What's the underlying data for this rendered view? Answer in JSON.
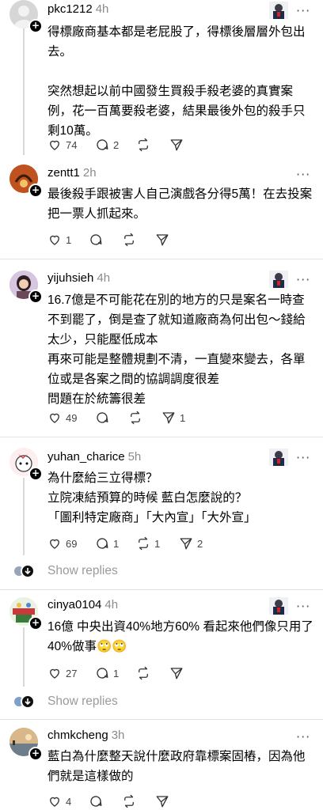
{
  "posts": [
    {
      "username": "pkc1212",
      "time": "4h",
      "lines": [
        "得標廠商基本都是老屁股了，得標後層層外包出去。",
        "",
        "突然想起以前中國發生買殺手殺老婆的真實案例，花一百萬要殺老婆，結果最後外包的殺手只剩10萬。"
      ],
      "likes": "74",
      "replies": "2",
      "reposts": "",
      "shares": ""
    },
    {
      "username": "zentt1",
      "time": "2h",
      "lines": [
        "最後殺手跟被害人自己演戲各分得5萬！在去投案把一票人抓起來。"
      ],
      "likes": "1",
      "replies": "",
      "reposts": "",
      "shares": ""
    },
    {
      "username": "yijuhsieh",
      "time": "4h",
      "lines": [
        "16.7億是不可能花在別的地方的只是案名一時查不到罷了，倒是查了就知道廠商為何出包～錢給太少，只能壓低成本",
        "再來可能是整體規劃不清，一直變來變去，各單位或是各案之間的協調調度很差",
        "問題在於統籌很差"
      ],
      "likes": "49",
      "replies": "",
      "reposts": "",
      "shares": "1"
    },
    {
      "username": "yuhan_charice",
      "time": "5h",
      "lines": [
        "為什麼給三立得標？",
        "立院凍結預算的時候  藍白怎麼說的？",
        "「圖利特定廠商」「大內宣」「大外宣」"
      ],
      "likes": "69",
      "replies": "1",
      "reposts": "1",
      "shares": "2",
      "show_replies": "Show replies"
    },
    {
      "username": "cinya0104",
      "time": "4h",
      "lines": [
        "16億 中央出資40%地方60%  看起來他們像只用了40%做事🙄🙄"
      ],
      "likes": "27",
      "replies": "1",
      "reposts": "",
      "shares": "",
      "show_replies": "Show replies"
    },
    {
      "username": "chmkcheng",
      "time": "3h",
      "lines": [
        "藍白為什麼整天說什麼政府靠標案固樁，因為他們就是這樣做的"
      ],
      "likes": "4",
      "replies": "",
      "reposts": "",
      "shares": ""
    }
  ],
  "icons": {
    "like": "heart-icon",
    "reply": "comment-icon",
    "repost": "repost-icon",
    "share": "send-icon",
    "more": "more-icon",
    "follow": "plus-icon"
  },
  "colors": {
    "text": "#000000",
    "muted": "#8a8a8a",
    "divider": "#e3e3e3"
  }
}
